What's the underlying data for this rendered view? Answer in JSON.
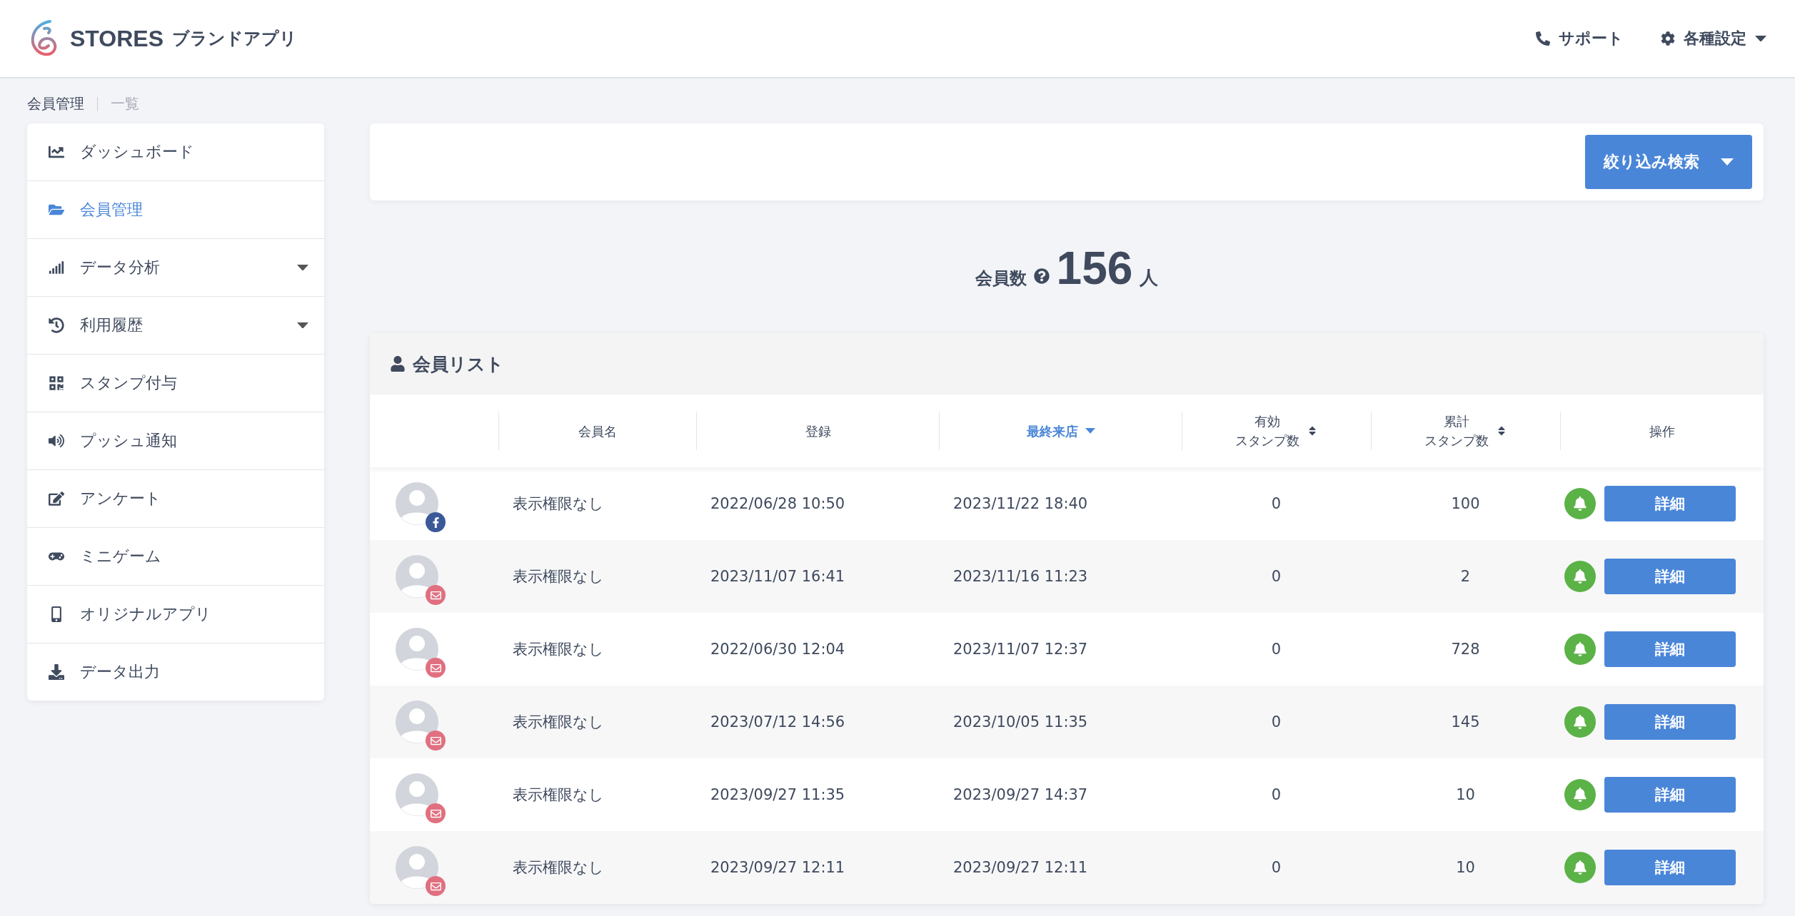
{
  "header": {
    "logo": {
      "brand": "STORES",
      "product": "ブランドアプリ"
    },
    "links": [
      {
        "label": "サポート",
        "kind": "support",
        "dropdown": false
      },
      {
        "label": "各種設定",
        "kind": "settings",
        "dropdown": true
      }
    ]
  },
  "breadcrumb": [
    "会員管理",
    "一覧"
  ],
  "sidebar": {
    "items": [
      {
        "label": "ダッシュボード",
        "selected": false,
        "submenu": false
      },
      {
        "label": "会員管理",
        "selected": true,
        "submenu": false
      },
      {
        "label": "データ分析",
        "selected": false,
        "submenu": true
      },
      {
        "label": "利用履歴",
        "selected": false,
        "submenu": true
      },
      {
        "label": "スタンプ付与",
        "selected": false,
        "submenu": false
      },
      {
        "label": "プッシュ通知",
        "selected": false,
        "submenu": false
      },
      {
        "label": "アンケート",
        "selected": false,
        "submenu": false
      },
      {
        "label": "ミニゲーム",
        "selected": false,
        "submenu": false
      },
      {
        "label": "オリジナルアプリ",
        "selected": false,
        "submenu": false
      },
      {
        "label": "データ出力",
        "selected": false,
        "submenu": false
      }
    ]
  },
  "filter_button": "絞り込み検索",
  "member_count": {
    "label": "会員数",
    "value": "156",
    "unit": "人"
  },
  "member_list": {
    "title": "会員リスト",
    "columns": [
      {
        "lines": [
          "会員名"
        ],
        "sortable": false,
        "selected": false
      },
      {
        "lines": [
          "登録"
        ],
        "sortable": false,
        "selected": false
      },
      {
        "lines": [
          "最終来店"
        ],
        "sortable": false,
        "selected": true
      },
      {
        "lines": [
          "有効",
          "スタンプ数"
        ],
        "sortable": true,
        "selected": false
      },
      {
        "lines": [
          "累計",
          "スタンプ数"
        ],
        "sortable": true,
        "selected": false
      },
      {
        "lines": [
          "操作"
        ],
        "sortable": false,
        "selected": false
      }
    ],
    "rows": [
      {
        "kind": "facebook",
        "name": "表示権限なし",
        "registered": "2022/06/28 10:50",
        "last_visit": "2023/11/22 18:40",
        "active_stamps": "0",
        "total_stamps": "100",
        "action": "詳細"
      },
      {
        "kind": "email",
        "name": "表示権限なし",
        "registered": "2023/11/07 16:41",
        "last_visit": "2023/11/16 11:23",
        "active_stamps": "0",
        "total_stamps": "2",
        "action": "詳細"
      },
      {
        "kind": "email",
        "name": "表示権限なし",
        "registered": "2022/06/30 12:04",
        "last_visit": "2023/11/07 12:37",
        "active_stamps": "0",
        "total_stamps": "728",
        "action": "詳細"
      },
      {
        "kind": "email",
        "name": "表示権限なし",
        "registered": "2023/07/12 14:56",
        "last_visit": "2023/10/05 11:35",
        "active_stamps": "0",
        "total_stamps": "145",
        "action": "詳細"
      },
      {
        "kind": "email",
        "name": "表示権限なし",
        "registered": "2023/09/27 11:35",
        "last_visit": "2023/09/27 14:37",
        "active_stamps": "0",
        "total_stamps": "10",
        "action": "詳細"
      },
      {
        "kind": "email",
        "name": "表示権限なし",
        "registered": "2023/09/27 12:11",
        "last_visit": "2023/09/27 12:11",
        "active_stamps": "0",
        "total_stamps": "10",
        "action": "詳細"
      }
    ]
  }
}
